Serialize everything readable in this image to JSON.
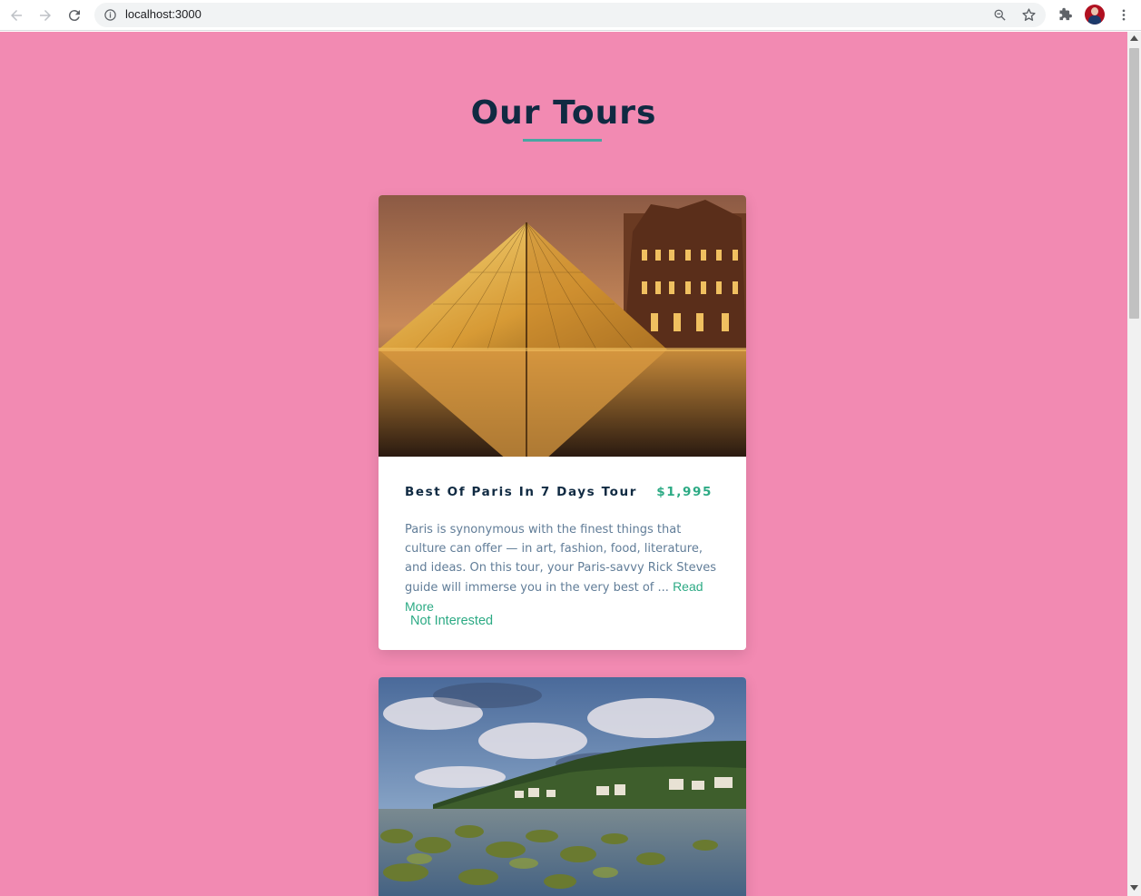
{
  "browser": {
    "url": "localhost:3000"
  },
  "page": {
    "title": "Our Tours"
  },
  "tours": [
    {
      "name": "Best Of Paris In 7 Days Tour",
      "price": "$1,995",
      "description": "Paris is synonymous with the finest things that culture can offer — in art, fashion, food, literature, and ideas. On this tour, your Paris-savvy Rick Steves guide will immerse you in the very best of ...",
      "read_more": "Read More",
      "not_interested": "Not Interested",
      "image_icon": "louvre-pyramid-photo"
    },
    {
      "image_icon": "irish-coast-photo"
    }
  ],
  "colors": {
    "background": "#f28ab2",
    "accent": "#2caa84",
    "heading": "#102a42",
    "text": "#617d98"
  }
}
